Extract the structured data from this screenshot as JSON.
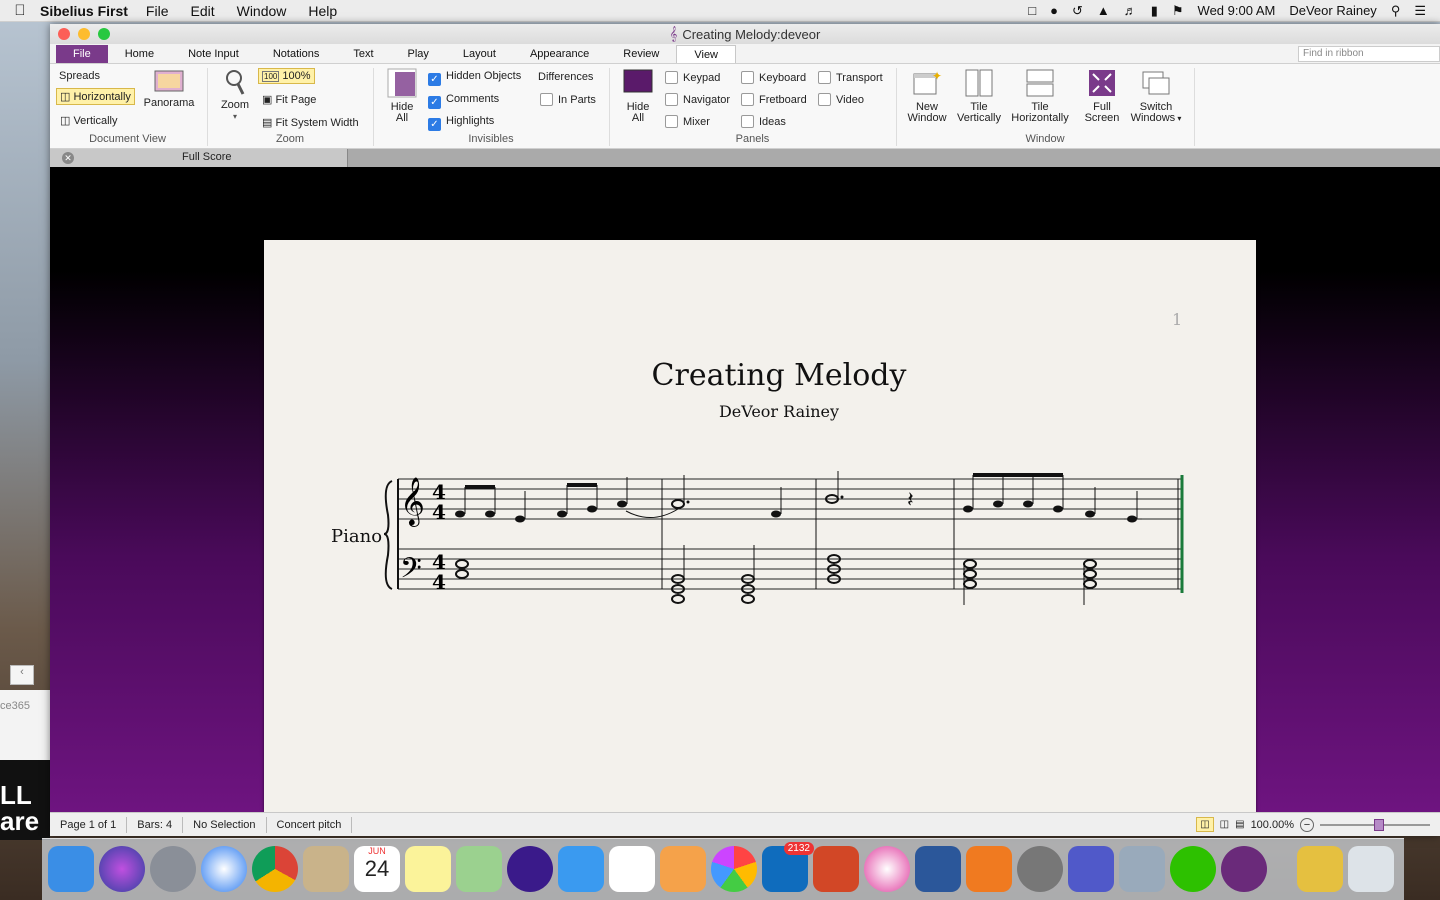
{
  "menubar": {
    "app": "Sibelius First",
    "items": [
      "File",
      "Edit",
      "Window",
      "Help"
    ],
    "time": "Wed 9:00 AM",
    "user": "DeVeor Rainey"
  },
  "window": {
    "title": "Creating Melody:deveor"
  },
  "ribbon": {
    "tabs": [
      "File",
      "Home",
      "Note Input",
      "Notations",
      "Text",
      "Play",
      "Layout",
      "Appearance",
      "Review",
      "View"
    ],
    "active_tab": "View",
    "find_placeholder": "Find in ribbon",
    "document_view": {
      "label": "Document View",
      "spreads": "Spreads",
      "horizontally": "Horizontally",
      "vertically": "Vertically",
      "panorama": "Panorama"
    },
    "zoom": {
      "label": "Zoom",
      "zoom": "Zoom",
      "percent": "100%",
      "fit_page": "Fit Page",
      "fit_system_width": "Fit System Width"
    },
    "invisibles": {
      "label": "Invisibles",
      "hide_all_1": "Hide",
      "hide_all_2": "All",
      "hidden_objects": "Hidden Objects",
      "comments": "Comments",
      "highlights": "Highlights",
      "differences": "Differences",
      "in_parts": "In Parts"
    },
    "panels": {
      "label": "Panels",
      "hide_all_1": "Hide",
      "hide_all_2": "All",
      "keypad": "Keypad",
      "navigator": "Navigator",
      "mixer": "Mixer",
      "keyboard": "Keyboard",
      "fretboard": "Fretboard",
      "ideas": "Ideas",
      "transport": "Transport",
      "video": "Video"
    },
    "window_group": {
      "label": "Window",
      "new_window_1": "New",
      "new_window_2": "Window",
      "tile_v_1": "Tile",
      "tile_v_2": "Vertically",
      "tile_h_1": "Tile",
      "tile_h_2": "Horizontally",
      "full_1": "Full",
      "full_2": "Screen",
      "switch_1": "Switch",
      "switch_2": "Windows"
    }
  },
  "doc_tab": "Full Score",
  "score": {
    "page_number": "1",
    "title": "Creating Melody",
    "composer": "DeVeor Rainey",
    "instrument": "Piano"
  },
  "status": {
    "page": "Page 1 of 1",
    "bars": "Bars: 4",
    "selection": "No Selection",
    "pitch": "Concert pitch",
    "zoom": "100.00%"
  },
  "side": {
    "text1": "ce365",
    "text2": "LL",
    "text3": "are"
  },
  "dock": {
    "outlook_badge": "2132",
    "calendar_month": "JUN",
    "calendar_day": "24"
  },
  "colors": {
    "accent": "#7a3a8a",
    "checkbox": "#2c7be5"
  }
}
